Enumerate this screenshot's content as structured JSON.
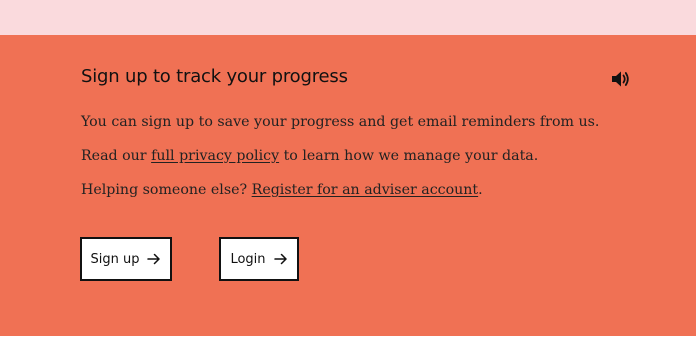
{
  "panel": {
    "title": "Sign up to track your progress",
    "paragraph1": "You can sign up to save your progress and get email reminders from us.",
    "paragraph2": {
      "before": "Read our ",
      "link": "full privacy policy",
      "after": " to learn how we manage your data."
    },
    "paragraph3": {
      "before": "Helping someone else? ",
      "link": "Register for an adviser account",
      "after": "."
    },
    "buttons": {
      "signup": "Sign up",
      "login": "Login"
    },
    "icons": {
      "audio": "speaker-icon",
      "arrow": "arrow-right-icon"
    }
  },
  "colors": {
    "top_strip": "#fadadd",
    "panel_background": "#f07154",
    "text": "#111111"
  }
}
